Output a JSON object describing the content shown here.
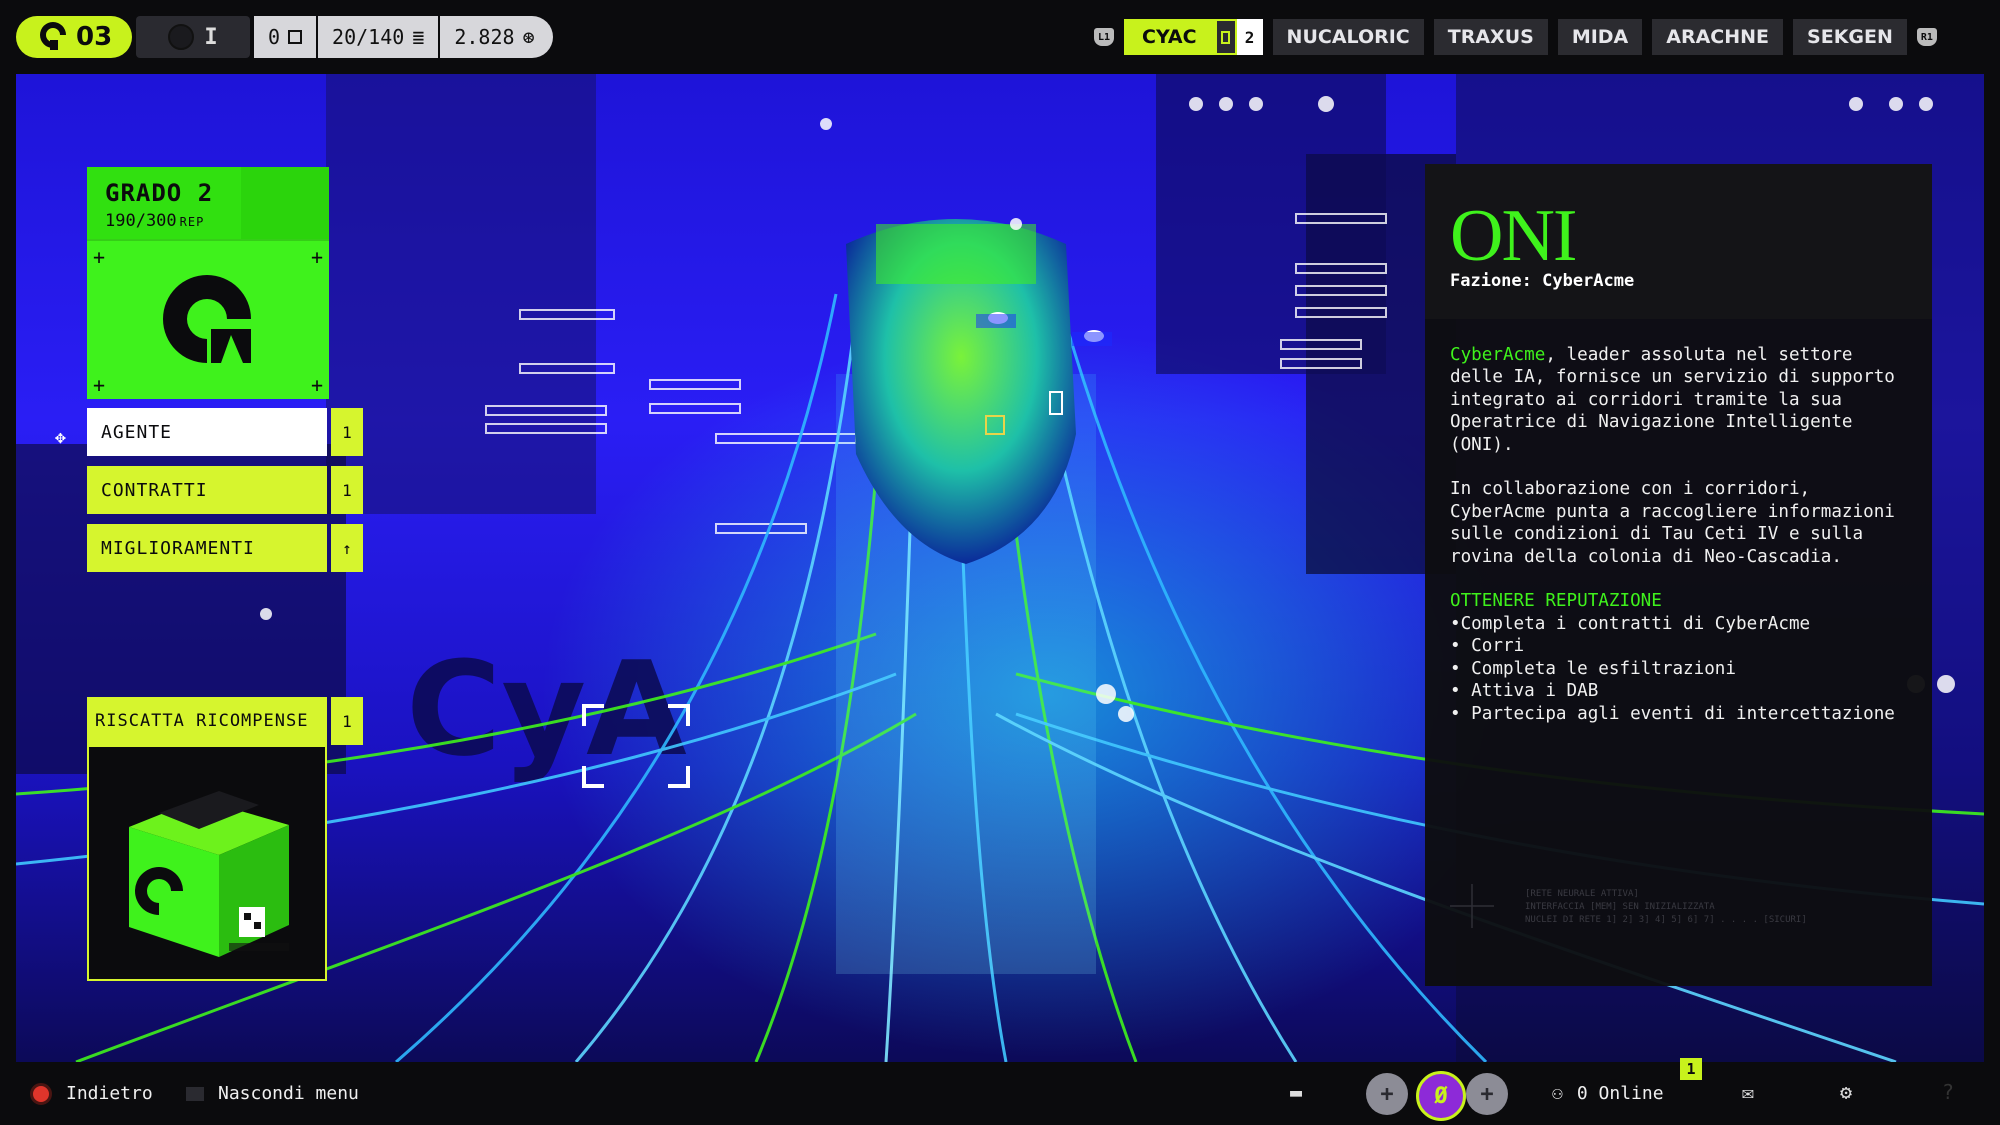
{
  "topbar": {
    "level": "03",
    "char_indicator": "I",
    "stats": [
      "0",
      "20/140",
      "2.828"
    ],
    "left_badge": "L1",
    "right_badge": "R1",
    "factions": [
      "CYAC",
      "NUCALORIC",
      "TRAXUS",
      "MIDA",
      "ARACHNE",
      "SEKGEN"
    ],
    "active_faction_count": "2"
  },
  "rank": {
    "title": "GRADO 2",
    "rep_value": "190/300",
    "rep_unit": "REP"
  },
  "menu": [
    {
      "label": "AGENTE",
      "count": "1"
    },
    {
      "label": "CONTRATTI",
      "count": "1"
    },
    {
      "label": "MIGLIORAMENTI",
      "count": "↑"
    }
  ],
  "reward": {
    "label": "RISCATTA RICOMPENSE",
    "count": "1"
  },
  "info": {
    "name": "ONI",
    "faction": "Fazione: CyberAcme",
    "intro_highlight": "CyberAcme",
    "intro_rest": ", leader assoluta nel settore delle IA, fornisce un servizio di supporto integrato ai corridori tramite la sua Operatrice di Navigazione Intelligente (ONI).",
    "para2": "In collaborazione con i corridori, CyberAcme punta a raccogliere informazioni sulle condizioni di Tau Ceti IV e sulla rovina della colonia di Neo-Cascadia.",
    "section_title": "OTTENERE REPUTAZIONE",
    "bullets": [
      "•Completa i contratti di CyberAcme",
      "• Corri",
      "• Completa le esfiltrazioni",
      "• Attiva i DAB",
      "• Partecipa agli eventi di intercettazione"
    ],
    "system_lines": [
      "[RETE NEURALE ATTIVA]",
      "INTERFACCIA [MEM] SEN INIZIALIZZATA",
      "NUCLEI DI RETE 1] 2] 3] 4] 5] 6] 7] . . . . [SICURI]"
    ]
  },
  "bottombar": {
    "back": "Indietro",
    "hide_menu": "Nascondi menu",
    "online": "0 Online",
    "notif_count": "1"
  },
  "colors": {
    "accent_green": "#3ff21c",
    "accent_lime": "#c8f21c",
    "hero_blue": "#2a1ef5",
    "panel_dark": "#0e0e10"
  }
}
